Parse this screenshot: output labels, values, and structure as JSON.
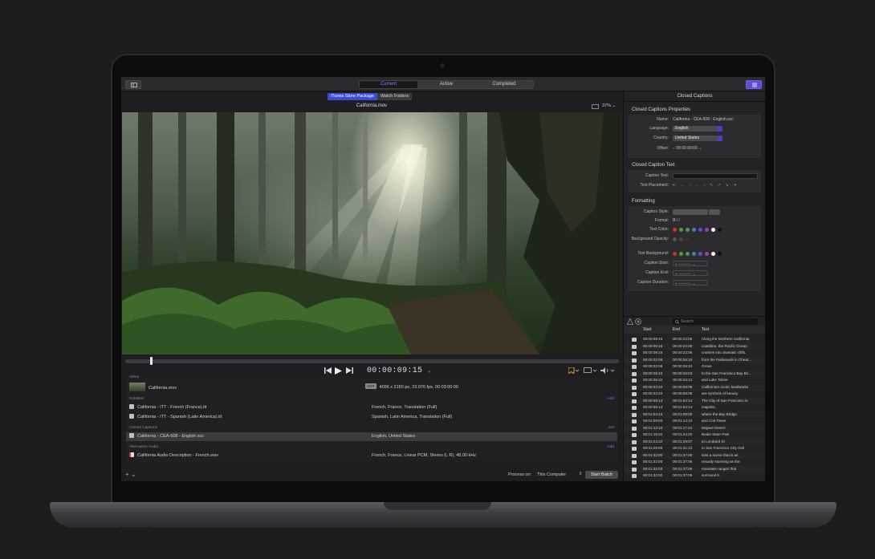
{
  "titlebar": {
    "tabs": [
      "Current",
      "Active",
      "Completed"
    ],
    "active_tab": 0
  },
  "segmented": [
    "iTunes Store Package",
    "Watch Folders"
  ],
  "viewer": {
    "clip_title": "California.mov",
    "zoom": "37%",
    "timecode": "00:00:09:15"
  },
  "list": {
    "video_section": "Video",
    "video": {
      "name": "California.mov",
      "badge": "SDR",
      "info": "4096 x 2160 px, 23.976 fps, 00:03:00:00"
    },
    "subtitles_section": "Subtitles",
    "subtitles_add": "Add",
    "subtitles": [
      {
        "name": "California - ITT - French (France).itt",
        "info": "French, France, Translation (Full)"
      },
      {
        "name": "California - ITT - Spanish (Latin America).itt",
        "info": "Spanish, Latin America, Translation (Full)"
      }
    ],
    "captions_section": "Closed Captions",
    "captions_set": "Set",
    "caption_file": {
      "name": "California - CEA-608 - English.scc",
      "info": "English, United States"
    },
    "audio_section": "Alternative Audio",
    "audio_add": "Add",
    "audio_file": {
      "name": "California Audio Description - French.wav",
      "info": "French, France, Linear PCM, Stereo (L R), 48.00 kHz"
    }
  },
  "bottom": {
    "process_label": "Process on:",
    "process_value": "This Computer",
    "start_batch": "Start Batch"
  },
  "inspector": {
    "title": "Closed Captions",
    "props_head": "Closed Captions Properties",
    "name_label": "Name:",
    "name_value": "California - CEA-608 - English.scc",
    "language_label": "Language:",
    "language_value": "English",
    "country_label": "Country:",
    "country_value": "United States",
    "offset_label": "Offset:",
    "offset_value": "00:00:00:00",
    "text_head": "Closed Caption Text",
    "caption_text_label": "Caption Text:",
    "placement_label": "Text Placement:",
    "formatting_head": "Formatting",
    "style_label": "Caption Style:",
    "format_label": "Format:",
    "text_color_label": "Text Color:",
    "bg_opacity_label": "Background Opacity:",
    "text_bg_label": "Text Background:",
    "start_label": "Caption Start:",
    "end_label": "Caption End:",
    "duration_label": "Caption Duration:",
    "tc_placeholder": "--:--:--:--",
    "text_colors": [
      "#c0392b",
      "#6b8f3a",
      "#4d9a4d",
      "#3f7fb8",
      "#5b4fd6",
      "#9b3fb8",
      "#ffffff",
      "#111111"
    ],
    "bg_colors": [
      "#c0392b",
      "#6b8f3a",
      "#4d9a4d",
      "#3f7fb8",
      "#5b4fd6",
      "#9b3fb8",
      "#ffffff",
      "#111111"
    ]
  },
  "captions": {
    "search_placeholder": "Search",
    "headers": [
      "Start",
      "End",
      "Text"
    ],
    "rows": [
      [
        "00:00:09:16",
        "00:00:22:06",
        "Along the Northern California"
      ],
      [
        "00:00:09:16",
        "00:00:22:06",
        "coastline, the Pacific Ocean"
      ],
      [
        "00:00:09:16",
        "00:00:22:06",
        "crashes into dramatic cliffs."
      ],
      [
        "00:00:22:06",
        "00:00:26:10",
        "from the Redwoods in Cheat..."
      ],
      [
        "00:00:22:06",
        "00:00:26:10",
        "Grove"
      ],
      [
        "00:00:26:10",
        "00:00:36:03",
        "to the San Francisco Bay Bri..."
      ],
      [
        "00:00:36:22",
        "00:00:43:12",
        "and Lake Tahoe"
      ],
      [
        "00:00:43:19",
        "00:00:58:08",
        "California's iconic landmarks"
      ],
      [
        "00:00:43:19",
        "00:00:58:08",
        "are symbols of beauty."
      ],
      [
        "00:00:58:14",
        "00:01:04:14",
        "The City of San Francisco is"
      ],
      [
        "00:00:58:14",
        "00:01:04:14",
        "majestic,"
      ],
      [
        "00:01:04:15",
        "00:01:09:00",
        "where the Bay Bridge"
      ],
      [
        "00:01:09:00",
        "00:01:13:10",
        "and Coit Tower"
      ],
      [
        "00:01:13:18",
        "00:01:17:22",
        "Mojave Desert"
      ],
      [
        "00:01:19:20",
        "00:01:24:20",
        "Bodie State Park"
      ],
      [
        "00:01:24:22",
        "00:01:29:07",
        "to Lombard St"
      ],
      [
        "00:01:29:08",
        "00:01:31:23",
        "to San Francisco City Hall"
      ],
      [
        "00:01:32:00",
        "00:01:37:06",
        "sets a scene that is as"
      ],
      [
        "00:01:32:00",
        "00:01:37:06",
        "visually stunning as the"
      ],
      [
        "00:01:32:00",
        "00:01:37:06",
        "mountain ranges that"
      ],
      [
        "00:01:32:00",
        "00:01:37:06",
        "surround it."
      ]
    ]
  }
}
